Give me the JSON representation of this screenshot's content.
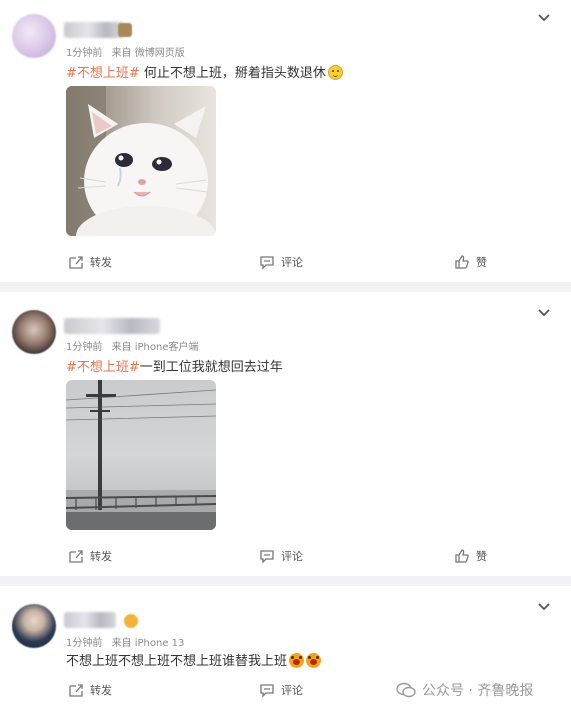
{
  "posts": [
    {
      "time": "1分钟前",
      "source": "来自 微博网页版",
      "hashtag": "#不想上班#",
      "text": " 何止不想上班，掰着指头数退休",
      "emoji": "smile-emoji",
      "image": "crying-cat",
      "actions": {
        "repost": "转发",
        "comment": "评论",
        "like": "赞"
      }
    },
    {
      "time": "1分钟前",
      "source": "来自 iPhone客户端",
      "hashtag": "#不想上班#",
      "text": "一到工位我就想回去过年",
      "image": "foggy-railway",
      "actions": {
        "repost": "转发",
        "comment": "评论",
        "like": "赞"
      }
    },
    {
      "time": "1分钟前",
      "source": "来自 iPhone 13",
      "text": "不想上班不想上班不想上班谁替我上班",
      "emoji": "crying-emoji",
      "actions": {
        "repost": "转发",
        "comment": "评论"
      }
    }
  ],
  "watermark": {
    "text": "公众号 · 齐鲁晚报"
  },
  "colors": {
    "hashtag": "#eb7350",
    "meta": "#8a8a8a",
    "divider": "#f1f2f5"
  }
}
